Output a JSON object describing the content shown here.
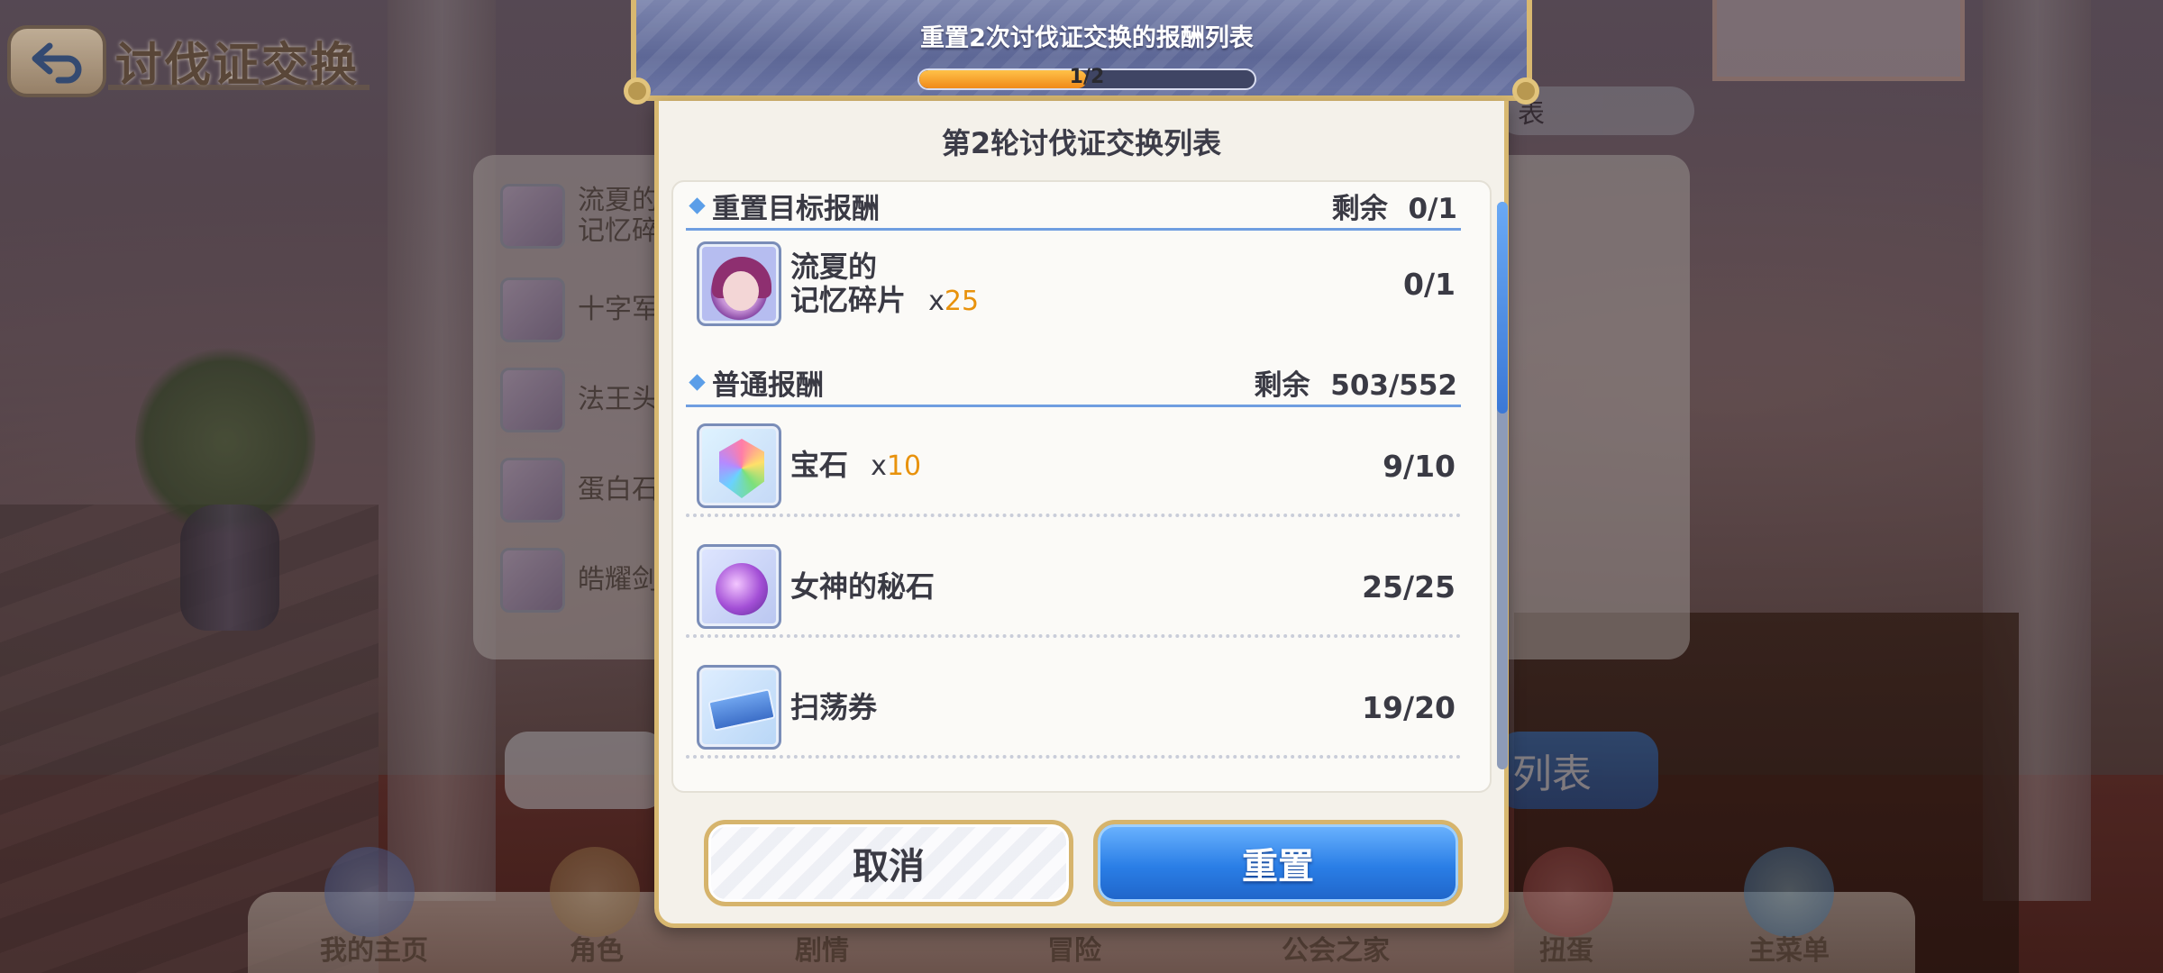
{
  "background": {
    "screen_title": "讨伐证交换",
    "behind_list_items": [
      "流夏的\n记忆碎",
      "十字军",
      "法王头",
      "蛋白石",
      "皓耀剑"
    ],
    "behind_tab": "表",
    "behind_button": "列表",
    "nav_items": [
      "我的主页",
      "角色",
      "剧情",
      "冒险",
      "公会之家",
      "扭蛋",
      "主菜单"
    ]
  },
  "dialog": {
    "header_title": "重置2次讨伐证交换的报酬列表",
    "progress": {
      "label": "1/2",
      "current": 1,
      "total": 2
    },
    "subtitle": "第2轮讨伐证交换列表",
    "sections": [
      {
        "title": "重置目标报酬",
        "remaining_label": "剩余",
        "remaining": "0/1",
        "items": [
          {
            "icon": "memory-fragment-icon",
            "name_line1": "流夏的",
            "name_line2": "记忆碎片",
            "qty_prefix": "x",
            "qty": "25",
            "count": "0/1"
          }
        ]
      },
      {
        "title": "普通报酬",
        "remaining_label": "剩余",
        "remaining": "503/552",
        "items": [
          {
            "icon": "gem-icon",
            "name_line1": "宝石",
            "name_line2": "",
            "qty_prefix": "x",
            "qty": "10",
            "count": "9/10"
          },
          {
            "icon": "goddess-stone-icon",
            "name_line1": "女神的秘石",
            "name_line2": "",
            "qty_prefix": "",
            "qty": "",
            "count": "25/25"
          },
          {
            "icon": "sweep-ticket-icon",
            "name_line1": "扫荡券",
            "name_line2": "",
            "qty_prefix": "",
            "qty": "",
            "count": "19/20"
          }
        ]
      }
    ],
    "buttons": {
      "cancel": "取消",
      "reset": "重置"
    },
    "colors": {
      "accent_blue": "#2a7ee6",
      "gold_border": "#d8b870",
      "qty_orange": "#e8920c",
      "progress_orange": "#f08a1a"
    }
  }
}
